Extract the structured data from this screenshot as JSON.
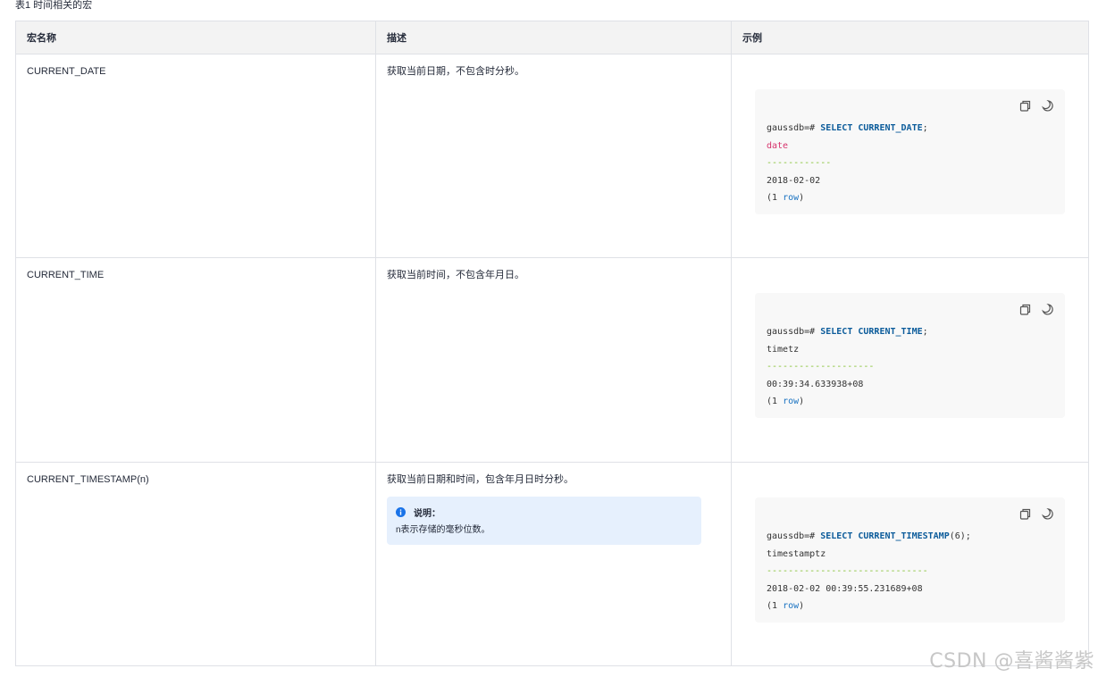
{
  "caption": "表1 时间相关的宏",
  "table": {
    "headers": [
      "宏名称",
      "描述",
      "示例"
    ],
    "rows": [
      {
        "name": "CURRENT_DATE",
        "description": "获取当前日期，不包含时分秒。",
        "example": {
          "prompt": "gaussdb=# ",
          "command": "SELECT CURRENT_DATE",
          "command_suffix": ";",
          "column": "date",
          "separator": "------------",
          "value": "2018-02-02",
          "row_open": "(1 ",
          "row_word": "row",
          "row_close": ")"
        }
      },
      {
        "name": "CURRENT_TIME",
        "description": "获取当前时间，不包含年月日。",
        "example": {
          "prompt": "gaussdb=# ",
          "command": "SELECT CURRENT_TIME",
          "command_suffix": ";",
          "column": "timetz",
          "separator": "--------------------",
          "value": "00:39:34.633938+08",
          "row_open": "(1 ",
          "row_word": "row",
          "row_close": ")"
        }
      },
      {
        "name": "CURRENT_TIMESTAMP(n)",
        "description": "获取当前日期和时间，包含年月日时分秒。",
        "note": {
          "title": "说明：",
          "body": "n表示存储的毫秒位数。"
        },
        "example": {
          "prompt": "gaussdb=# ",
          "command": "SELECT CURRENT_TIMESTAMP",
          "command_suffix": "(6);",
          "column": "timestamptz",
          "separator": "------------------------------",
          "value": "2018-02-02 00:39:55.231689+08",
          "row_open": "(1 ",
          "row_word": "row",
          "row_close": ")"
        }
      }
    ]
  },
  "icons": {
    "copy": "copy-icon",
    "theme": "moon-icon",
    "info": "info-icon"
  },
  "colors": {
    "keyword": "#0c5c9b",
    "type_word": "#d6336c",
    "separator": "#7fbf2a",
    "note_bg": "#e6f0fd",
    "info": "#1a73e8"
  },
  "watermark": "CSDN @喜酱酱紫"
}
